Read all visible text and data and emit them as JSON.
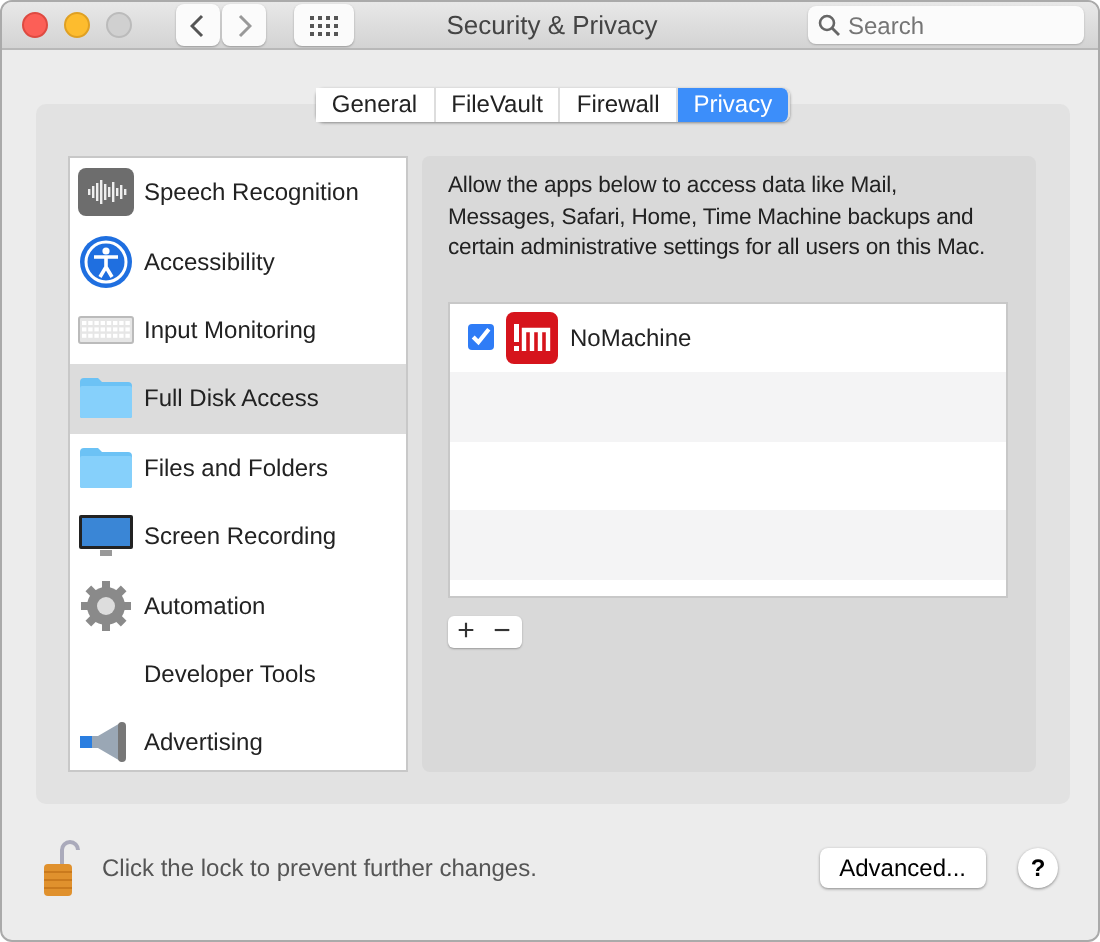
{
  "window": {
    "title": "Security & Privacy"
  },
  "search": {
    "placeholder": "Search"
  },
  "tabs": [
    {
      "label": "General",
      "selected": false
    },
    {
      "label": "FileVault",
      "selected": false
    },
    {
      "label": "Firewall",
      "selected": false
    },
    {
      "label": "Privacy",
      "selected": true
    }
  ],
  "sidebar": {
    "items": [
      {
        "label": "Speech Recognition",
        "selected": false
      },
      {
        "label": "Accessibility",
        "selected": false
      },
      {
        "label": "Input Monitoring",
        "selected": false
      },
      {
        "label": "Full Disk Access",
        "selected": true
      },
      {
        "label": "Files and Folders",
        "selected": false
      },
      {
        "label": "Screen Recording",
        "selected": false
      },
      {
        "label": "Automation",
        "selected": false
      },
      {
        "label": "Developer Tools",
        "selected": false
      },
      {
        "label": "Advertising",
        "selected": false
      }
    ]
  },
  "description": "Allow the apps below to access data like Mail, Messages, Safari, Home, Time Machine backups and certain administrative settings for all users on this Mac.",
  "apps": [
    {
      "name": "NoMachine",
      "checked": true
    }
  ],
  "list_buttons": [
    "+",
    "−"
  ],
  "lock_text": "Click the lock to prevent further changes.",
  "advanced_button": "Advanced...",
  "help_button": "?"
}
